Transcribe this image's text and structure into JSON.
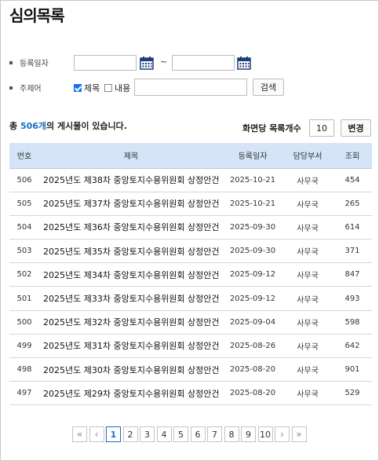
{
  "page_title": "심의목록",
  "search": {
    "date_label": "등록일자",
    "date_from": "",
    "date_to": "",
    "tilde": "~",
    "subject_label": "주제어",
    "check_title_label": "제목",
    "check_title_checked": true,
    "check_content_label": "내용",
    "check_content_checked": false,
    "keyword": "",
    "search_button": "검색"
  },
  "summary": {
    "prefix": "총 ",
    "count": "506개",
    "suffix": "의 게시물이 있습니다.",
    "per_page_label": "화면당 목록개수",
    "per_page_value": "10",
    "change_button": "변경"
  },
  "table": {
    "headers": [
      "번호",
      "제목",
      "등록일자",
      "담당부서",
      "조회"
    ],
    "rows": [
      {
        "num": "506",
        "title": "2025년도 제38차 중앙토지수용위원회 상정안건",
        "date": "2025-10-21",
        "dept": "사무국",
        "views": "454"
      },
      {
        "num": "505",
        "title": "2025년도 제37차 중앙토지수용위원회 상정안건",
        "date": "2025-10-21",
        "dept": "사무국",
        "views": "265"
      },
      {
        "num": "504",
        "title": "2025년도 제36차 중앙토지수용위원회 상정안건",
        "date": "2025-09-30",
        "dept": "사무국",
        "views": "614"
      },
      {
        "num": "503",
        "title": "2025년도 제35차 중앙토지수용위원회 상정안건",
        "date": "2025-09-30",
        "dept": "사무국",
        "views": "371"
      },
      {
        "num": "502",
        "title": "2025년도 제34차 중앙토지수용위원회 상정안건",
        "date": "2025-09-12",
        "dept": "사무국",
        "views": "847"
      },
      {
        "num": "501",
        "title": "2025년도 제33차 중앙토지수용위원회 상정안건",
        "date": "2025-09-12",
        "dept": "사무국",
        "views": "493"
      },
      {
        "num": "500",
        "title": "2025년도 제32차 중앙토지수용위원회 상정안건",
        "date": "2025-09-04",
        "dept": "사무국",
        "views": "598"
      },
      {
        "num": "499",
        "title": "2025년도 제31차 중앙토지수용위원회 상정안건",
        "date": "2025-08-26",
        "dept": "사무국",
        "views": "642"
      },
      {
        "num": "498",
        "title": "2025년도 제30차 중앙토지수용위원회 상정안건",
        "date": "2025-08-20",
        "dept": "사무국",
        "views": "901"
      },
      {
        "num": "497",
        "title": "2025년도 제29차 중앙토지수용위원회 상정안건",
        "date": "2025-08-20",
        "dept": "사무국",
        "views": "529"
      }
    ]
  },
  "pagination": {
    "first": "«",
    "prev": "‹",
    "pages": [
      "1",
      "2",
      "3",
      "4",
      "5",
      "6",
      "7",
      "8",
      "9",
      "10"
    ],
    "current": "1",
    "next": "›",
    "last": "»"
  },
  "colors": {
    "accent": "#1a6fc4",
    "table_header_bg": "#d5e4f7",
    "checkbox": "#1a73e8"
  },
  "icons": {
    "calendar": "calendar-icon"
  }
}
